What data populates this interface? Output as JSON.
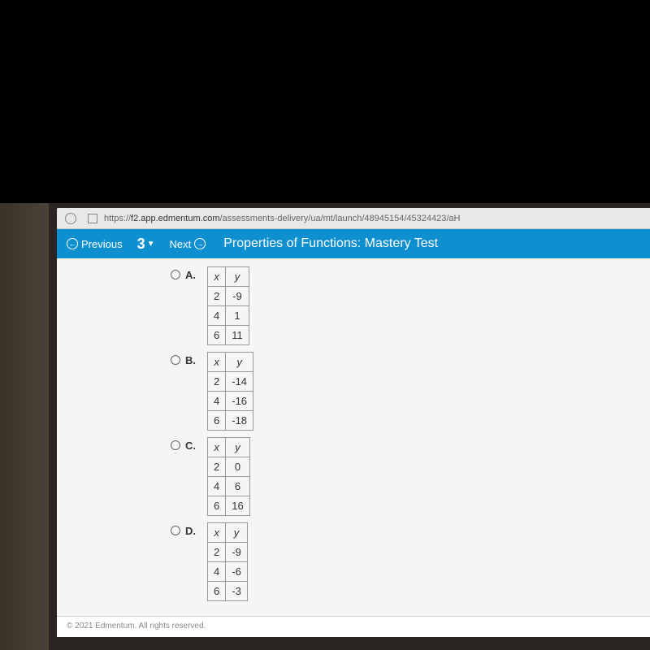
{
  "browser": {
    "url_prefix": "https://",
    "url_domain": "f2.app.edmentum.com",
    "url_path": "/assessments-delivery/ua/mt/launch/48945154/45324423/aH"
  },
  "nav": {
    "prev": "Previous",
    "number": "3",
    "next": "Next",
    "title": "Properties of Functions: Mastery Test"
  },
  "options": [
    {
      "label": "A.",
      "rows": [
        [
          "2",
          "-9"
        ],
        [
          "4",
          "1"
        ],
        [
          "6",
          "11"
        ]
      ]
    },
    {
      "label": "B.",
      "rows": [
        [
          "2",
          "-14"
        ],
        [
          "4",
          "-16"
        ],
        [
          "6",
          "-18"
        ]
      ]
    },
    {
      "label": "C.",
      "rows": [
        [
          "2",
          "0"
        ],
        [
          "4",
          "6"
        ],
        [
          "6",
          "16"
        ]
      ]
    },
    {
      "label": "D.",
      "rows": [
        [
          "2",
          "-9"
        ],
        [
          "4",
          "-6"
        ],
        [
          "6",
          "-3"
        ]
      ]
    }
  ],
  "headers": {
    "x": "x",
    "y": "y"
  },
  "footer": "© 2021 Edmentum. All rights reserved."
}
